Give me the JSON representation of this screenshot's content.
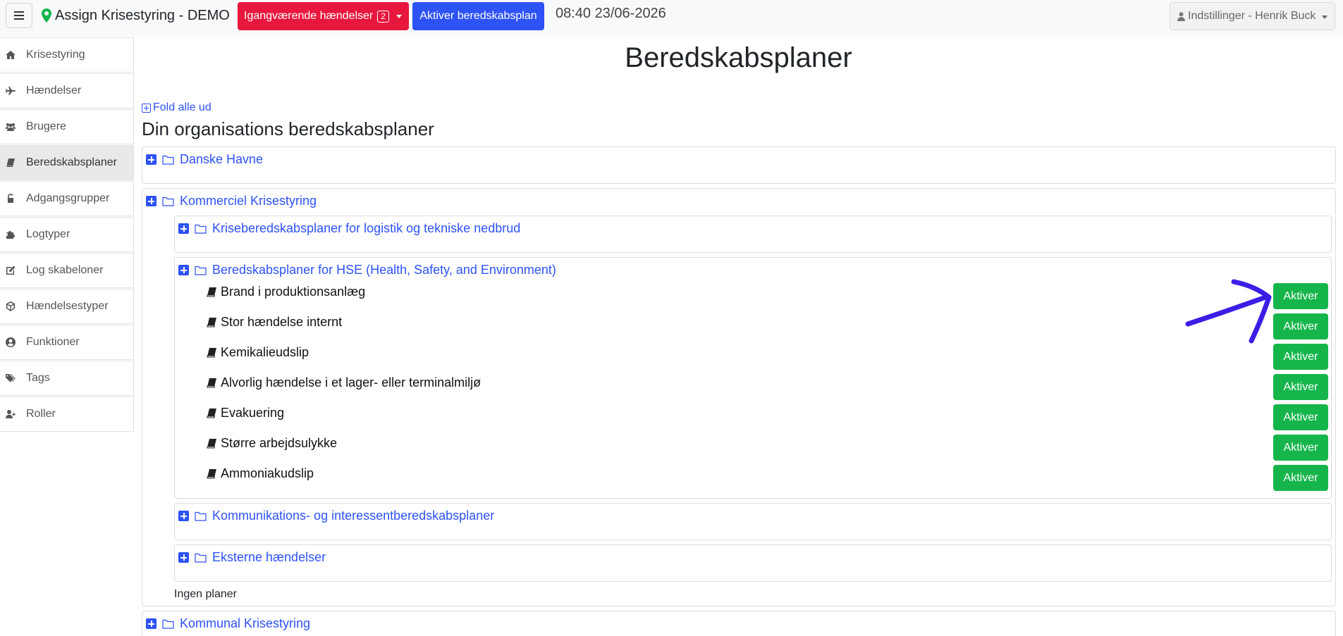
{
  "header": {
    "brand_title": "Assign Krisestyring - DEMO",
    "ongoing_label": "Igangværende hændelser",
    "ongoing_count": "2",
    "activate_plan_label": "Aktiver beredskabsplan",
    "datetime": "08:40 23/06-2026",
    "settings_label": "Indstillinger - Henrik Buck"
  },
  "sidebar": {
    "items": [
      {
        "label": "Krisestyring",
        "icon": "home-icon"
      },
      {
        "label": "Hændelser",
        "icon": "plane-icon"
      },
      {
        "label": "Brugere",
        "icon": "users-icon"
      },
      {
        "label": "Beredskabsplaner",
        "icon": "book-icon",
        "active": true
      },
      {
        "label": "Adgangsgrupper",
        "icon": "lock-icon"
      },
      {
        "label": "Logtyper",
        "icon": "puzzle-icon"
      },
      {
        "label": "Log skabeloner",
        "icon": "edit-icon"
      },
      {
        "label": "Hændelsestyper",
        "icon": "cube-icon"
      },
      {
        "label": "Funktioner",
        "icon": "user-circle-icon"
      },
      {
        "label": "Tags",
        "icon": "tags-icon"
      },
      {
        "label": "Roller",
        "icon": "user-plus-icon"
      }
    ]
  },
  "main": {
    "title": "Beredskabsplaner",
    "fold_all_label": "Fold alle ud",
    "section_heading": "Din organisations beredskabsplaner",
    "folders": {
      "danske_havne": "Danske Havne",
      "kommerciel": "Kommerciel Krisestyring",
      "logistik": "Kriseberedskabsplaner for logistik og tekniske nedbrud",
      "hse": "Beredskabsplaner for HSE (Health, Safety, and Environment)",
      "kommunikation": "Kommunikations- og interessentberedskabsplaner",
      "eksterne": "Eksterne hændelser",
      "kommunal": "Kommunal Krisestyring"
    },
    "hse_plans": [
      "Brand i produktionsanlæg",
      "Stor hændelse internt",
      "Kemikalieudslip",
      "Alvorlig hændelse i et lager- eller terminalmiljø",
      "Evakuering",
      "Større arbejdsulykke",
      "Ammoniakudslip"
    ],
    "activate_label": "Aktiver",
    "no_plans_label": "Ingen planer"
  },
  "colors": {
    "primary": "#2d52f5",
    "danger": "#e8173d",
    "success": "#16b54b",
    "annotation_arrow": "#3a1ee6"
  }
}
